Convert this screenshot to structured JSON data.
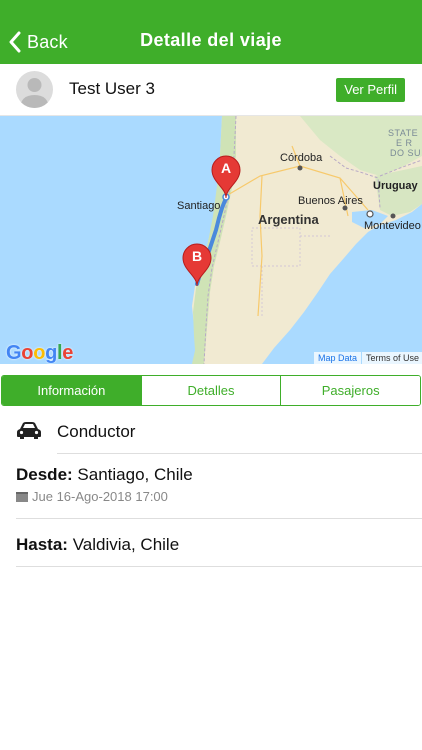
{
  "navbar": {
    "back_label": "Back",
    "title": "Detalle del viaje"
  },
  "user": {
    "name": "Test User 3",
    "profile_button": "Ver Perfil"
  },
  "map": {
    "labels": {
      "cordoba": "Córdoba",
      "santiago": "Santiago",
      "argentina": "Argentina",
      "buenos_aires": "Buenos Aires",
      "uruguay": "Uruguay",
      "montevideo": "Montevideo",
      "state_line1": "STATE",
      "state_line2": "E R",
      "state_line3": "DO SU"
    },
    "marker_a": "A",
    "marker_b": "B",
    "map_data": "Map Data",
    "terms": "Terms of Use",
    "route_color": "#4a89dc",
    "marker_color": "#e53935"
  },
  "tabs": [
    {
      "label": "Información",
      "active": true
    },
    {
      "label": "Detalles",
      "active": false
    },
    {
      "label": "Pasajeros",
      "active": false
    }
  ],
  "driver": {
    "icon": "car-icon",
    "label": "Conductor"
  },
  "trip": {
    "from_label": "Desde:",
    "from_value": "Santiago, Chile",
    "date": "Jue 16-Ago-2018 17:00",
    "date_icon": "calendar-icon",
    "to_label": "Hasta:",
    "to_value": "Valdivia, Chile"
  },
  "colors": {
    "accent": "#3fae2a"
  }
}
